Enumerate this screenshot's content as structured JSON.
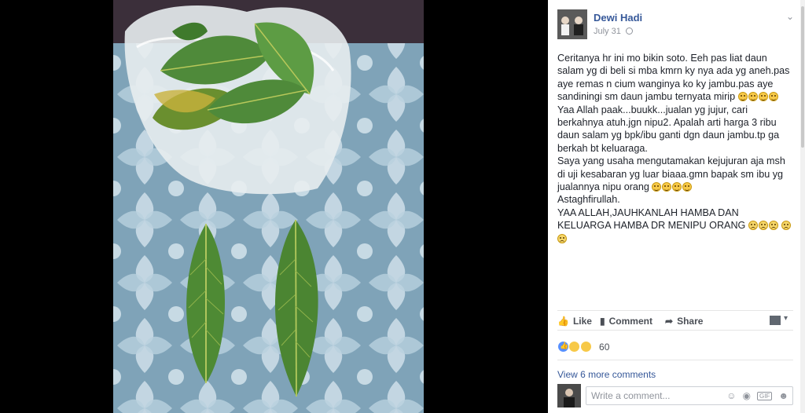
{
  "post": {
    "author": "Dewi Hadi",
    "date": "July 31",
    "menu_icon": "chevron-down-icon",
    "paragraphs": [
      "Ceritanya hr ini mo bikin soto. Eeh pas liat daun salam yg di beli si mba kmrn ky nya ada yg aneh.pas aye remas n cium wanginya ko ky jambu.pas aye sandiningi sm daun jambu ternyata mirip",
      "Yaa Allah paak...buukk...jualan yg jujur, cari berkahnya atuh.jgn nipu2. Apalah arti harga 3 ribu daun salam yg bpk/ibu ganti dgn daun jambu.tp ga berkah bt keluaraga.",
      "Saya yang usaha mengutamakan kejujuran aja msh di uji kesabaran yg luar biaaa.gmn bapak sm ibu yg jualannya nipu orang",
      "Astaghfirullah.",
      "YAA ALLAH,JAUHKANLAH HAMBA DAN KELUARGA HAMBA DR MENIPU ORANG"
    ]
  },
  "actions": {
    "like": "Like",
    "comment": "Comment",
    "share": "Share"
  },
  "reactions": {
    "count": "60",
    "icons": [
      "like-icon",
      "wow-icon",
      "haha-icon"
    ]
  },
  "comments": {
    "view_more": "View 6 more comments",
    "placeholder": "Write a comment...",
    "input_icons": [
      "emoji-icon",
      "camera-icon",
      "gif-icon",
      "sticker-icon"
    ]
  },
  "colors": {
    "link_blue": "#365899",
    "text": "#1d2129",
    "muted": "#90949c",
    "like_blue": "#5890ff"
  }
}
